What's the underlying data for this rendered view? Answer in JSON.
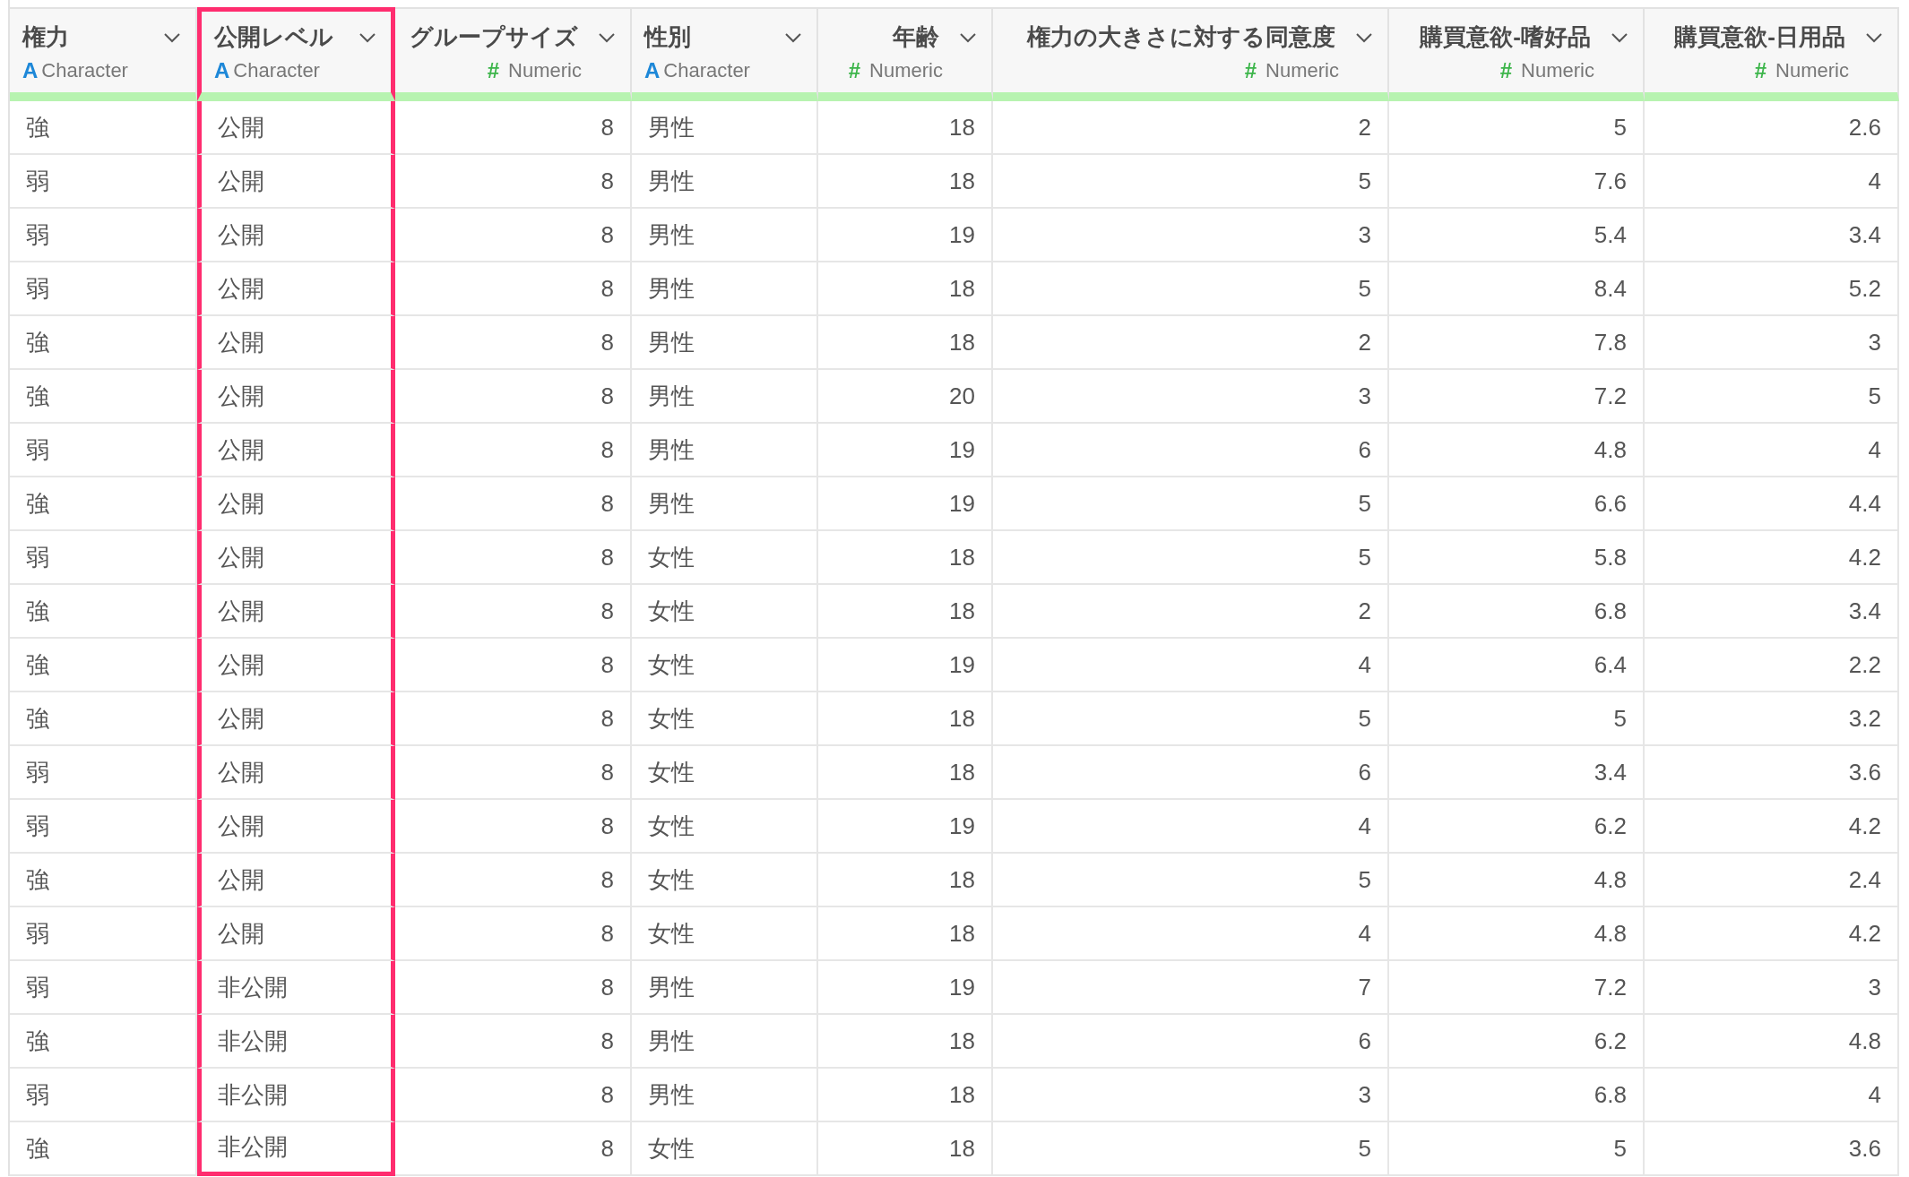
{
  "table": {
    "columns": [
      {
        "name": "権力",
        "type_icon": "A",
        "type": "Character",
        "kind": "character",
        "selected": false
      },
      {
        "name": "公開レベル",
        "type_icon": "A",
        "type": "Character",
        "kind": "character",
        "selected": true
      },
      {
        "name": "グループサイズ",
        "type_icon": "#",
        "type": "Numeric",
        "kind": "numeric",
        "selected": false
      },
      {
        "name": "性別",
        "type_icon": "A",
        "type": "Character",
        "kind": "character",
        "selected": false
      },
      {
        "name": "年齢",
        "type_icon": "#",
        "type": "Numeric",
        "kind": "numeric",
        "selected": false
      },
      {
        "name": "権力の大きさに対する同意度",
        "type_icon": "#",
        "type": "Numeric",
        "kind": "numeric",
        "selected": false
      },
      {
        "name": "購買意欲-嗜好品",
        "type_icon": "#",
        "type": "Numeric",
        "kind": "numeric",
        "selected": false
      },
      {
        "name": "購買意欲-日用品",
        "type_icon": "#",
        "type": "Numeric",
        "kind": "numeric",
        "selected": false
      }
    ],
    "rows": [
      [
        "強",
        "公開",
        "8",
        "男性",
        "18",
        "2",
        "5",
        "2.6"
      ],
      [
        "弱",
        "公開",
        "8",
        "男性",
        "18",
        "5",
        "7.6",
        "4"
      ],
      [
        "弱",
        "公開",
        "8",
        "男性",
        "19",
        "3",
        "5.4",
        "3.4"
      ],
      [
        "弱",
        "公開",
        "8",
        "男性",
        "18",
        "5",
        "8.4",
        "5.2"
      ],
      [
        "強",
        "公開",
        "8",
        "男性",
        "18",
        "2",
        "7.8",
        "3"
      ],
      [
        "強",
        "公開",
        "8",
        "男性",
        "20",
        "3",
        "7.2",
        "5"
      ],
      [
        "弱",
        "公開",
        "8",
        "男性",
        "19",
        "6",
        "4.8",
        "4"
      ],
      [
        "強",
        "公開",
        "8",
        "男性",
        "19",
        "5",
        "6.6",
        "4.4"
      ],
      [
        "弱",
        "公開",
        "8",
        "女性",
        "18",
        "5",
        "5.8",
        "4.2"
      ],
      [
        "強",
        "公開",
        "8",
        "女性",
        "18",
        "2",
        "6.8",
        "3.4"
      ],
      [
        "強",
        "公開",
        "8",
        "女性",
        "19",
        "4",
        "6.4",
        "2.2"
      ],
      [
        "強",
        "公開",
        "8",
        "女性",
        "18",
        "5",
        "5",
        "3.2"
      ],
      [
        "弱",
        "公開",
        "8",
        "女性",
        "18",
        "6",
        "3.4",
        "3.6"
      ],
      [
        "弱",
        "公開",
        "8",
        "女性",
        "19",
        "4",
        "6.2",
        "4.2"
      ],
      [
        "強",
        "公開",
        "8",
        "女性",
        "18",
        "5",
        "4.8",
        "2.4"
      ],
      [
        "弱",
        "公開",
        "8",
        "女性",
        "18",
        "4",
        "4.8",
        "4.2"
      ],
      [
        "弱",
        "非公開",
        "8",
        "男性",
        "19",
        "7",
        "7.2",
        "3"
      ],
      [
        "強",
        "非公開",
        "8",
        "男性",
        "18",
        "6",
        "6.2",
        "4.8"
      ],
      [
        "弱",
        "非公開",
        "8",
        "男性",
        "18",
        "3",
        "6.8",
        "4"
      ],
      [
        "強",
        "非公開",
        "8",
        "女性",
        "18",
        "5",
        "5",
        "3.6"
      ]
    ]
  }
}
